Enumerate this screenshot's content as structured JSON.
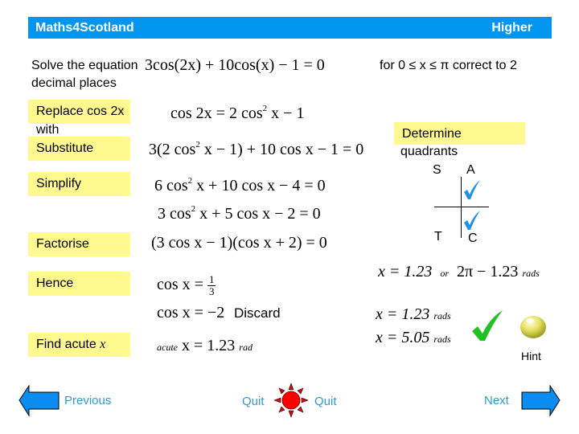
{
  "header": {
    "brand": "Maths4Scotland",
    "level": "Higher"
  },
  "question": {
    "prefix": "Solve the equation",
    "line2": "decimal places",
    "equation": "3cos(2x) + 10cos(x) − 1 = 0",
    "range": "for  0 ≤  x ≤ π   correct to 2"
  },
  "steps": [
    {
      "label": "Replace cos 2x",
      "label_extra": "with"
    },
    {
      "label": "Substitute"
    },
    {
      "label": "Simplify"
    },
    {
      "label": "Factorise"
    },
    {
      "label": "Hence"
    },
    {
      "label": "Find acute",
      "label_var": "x"
    }
  ],
  "math": {
    "identity_lhs": "cos 2x = 2 cos",
    "identity_rhs": "x − 1",
    "substitute": {
      "a": "3(2 cos",
      "b": "x − 1) + 10 cos x − 1 = 0"
    },
    "simplify1": {
      "a": "6 cos",
      "b": "x + 10 cos x − 4 = 0"
    },
    "simplify2": {
      "a": "3 cos",
      "b": "x + 5 cos x − 2 = 0"
    },
    "factorise": "(3 cos x − 1)(cos x + 2) = 0",
    "hence1": {
      "lhs": "cos x = ",
      "num": "1",
      "den": "3"
    },
    "hence2": "cos x = −2",
    "discard": "Discard",
    "acute": {
      "word": "acute",
      "expr": "x = 1.23",
      "unit": "rad"
    },
    "sup2": "2"
  },
  "quadrants": {
    "title_line1": "Determine",
    "title_line2": "quadrants",
    "S": "S",
    "A": "A",
    "T": "T",
    "C": "C"
  },
  "solutions": {
    "general": {
      "a": "x  =  1.23",
      "or": "or",
      "b": "2π − 1.23",
      "unit": "rads"
    },
    "sol1": {
      "expr": "x  =  1.23",
      "unit": "rads"
    },
    "sol2": {
      "expr": "x  =  5.05",
      "unit": "rads"
    }
  },
  "nav": {
    "previous": "Previous",
    "quit_left": "Quit",
    "quit_right": "Quit",
    "next": "Next",
    "hint": "Hint"
  },
  "colors": {
    "header": "#0096f0",
    "step_box": "#fff98f",
    "nav_text": "#3399cc",
    "check_blue": "#1e90e8",
    "check_green": "#22c022",
    "quit_red": "#ff0000"
  }
}
